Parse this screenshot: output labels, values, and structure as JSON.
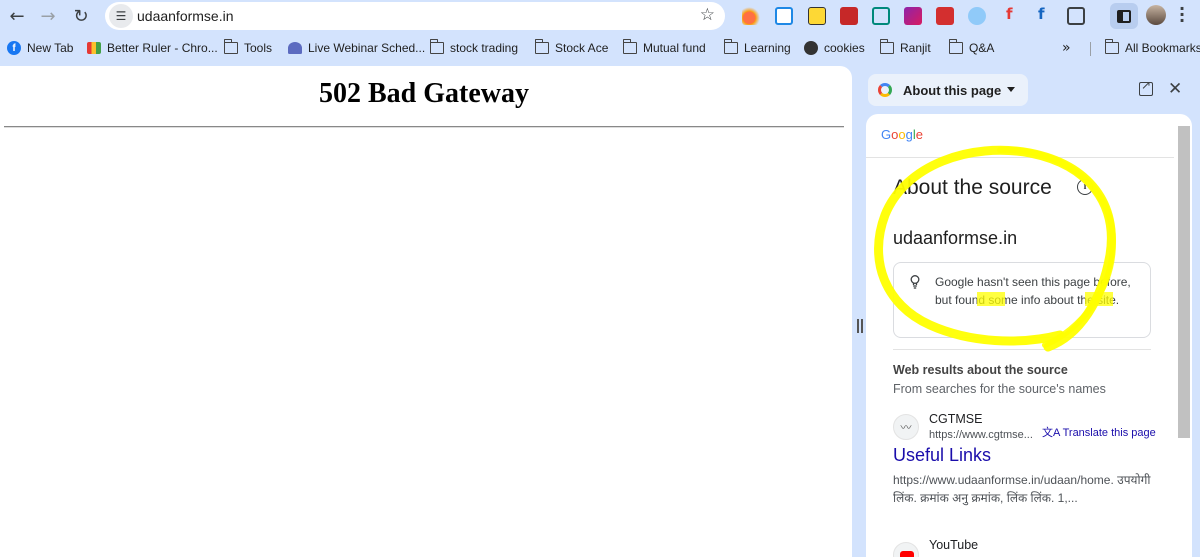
{
  "toolbar": {
    "back_glyph": "←",
    "forward_glyph": "→",
    "reload_glyph": "↻",
    "tune_glyph": "☰",
    "url": "udaanformse.in",
    "bookmark_star_glyph": "☆"
  },
  "bookmarks": {
    "items": [
      {
        "label": "New Tab",
        "icon": "facebook-icon"
      },
      {
        "label": "Better Ruler - Chro...",
        "icon": "ruler-icon"
      },
      {
        "label": "Tools",
        "icon": "folder-icon"
      },
      {
        "label": "Live Webinar Sched...",
        "icon": "webinar-icon"
      },
      {
        "label": "stock trading",
        "icon": "folder-icon"
      },
      {
        "label": "Stock Ace",
        "icon": "folder-icon"
      },
      {
        "label": "Mutual fund",
        "icon": "folder-icon"
      },
      {
        "label": "Learning",
        "icon": "folder-icon"
      },
      {
        "label": "cookies",
        "icon": "gear-icon"
      },
      {
        "label": "Ranjit",
        "icon": "folder-icon"
      },
      {
        "label": "Q&A",
        "icon": "folder-icon"
      }
    ],
    "more_glyph": "»",
    "all_bookmarks": "All Bookmarks"
  },
  "page": {
    "title": "502 Bad Gateway"
  },
  "side_panel": {
    "header_title": "About this page",
    "close_glyph": "✕",
    "google_logo": [
      "G",
      "o",
      "o",
      "g",
      "l",
      "e"
    ],
    "heading": "About the source",
    "info_glyph": "i",
    "domain": "udaanformse.in",
    "notice": "Google hasn't seen this page before, but found some info about the site.",
    "web_results_heading": "Web results about the source",
    "web_results_sub": "From searches for the source's names",
    "results": [
      {
        "site_name": "CGTMSE",
        "site_url": "https://www.cgtmse...",
        "translate": "Translate this page",
        "title": "Useful Links",
        "snippet": "https://www.udaanformse.in/udaan/home. उपयोगी लिंक. क्रमांक अनु क्रमांक, लिंक लिंक. 1,..."
      },
      {
        "site_name": "YouTube"
      }
    ]
  },
  "colors": {
    "chrome_bg": "#d3e3fd",
    "link": "#1a0dab",
    "highlighter": "#ffff00"
  }
}
